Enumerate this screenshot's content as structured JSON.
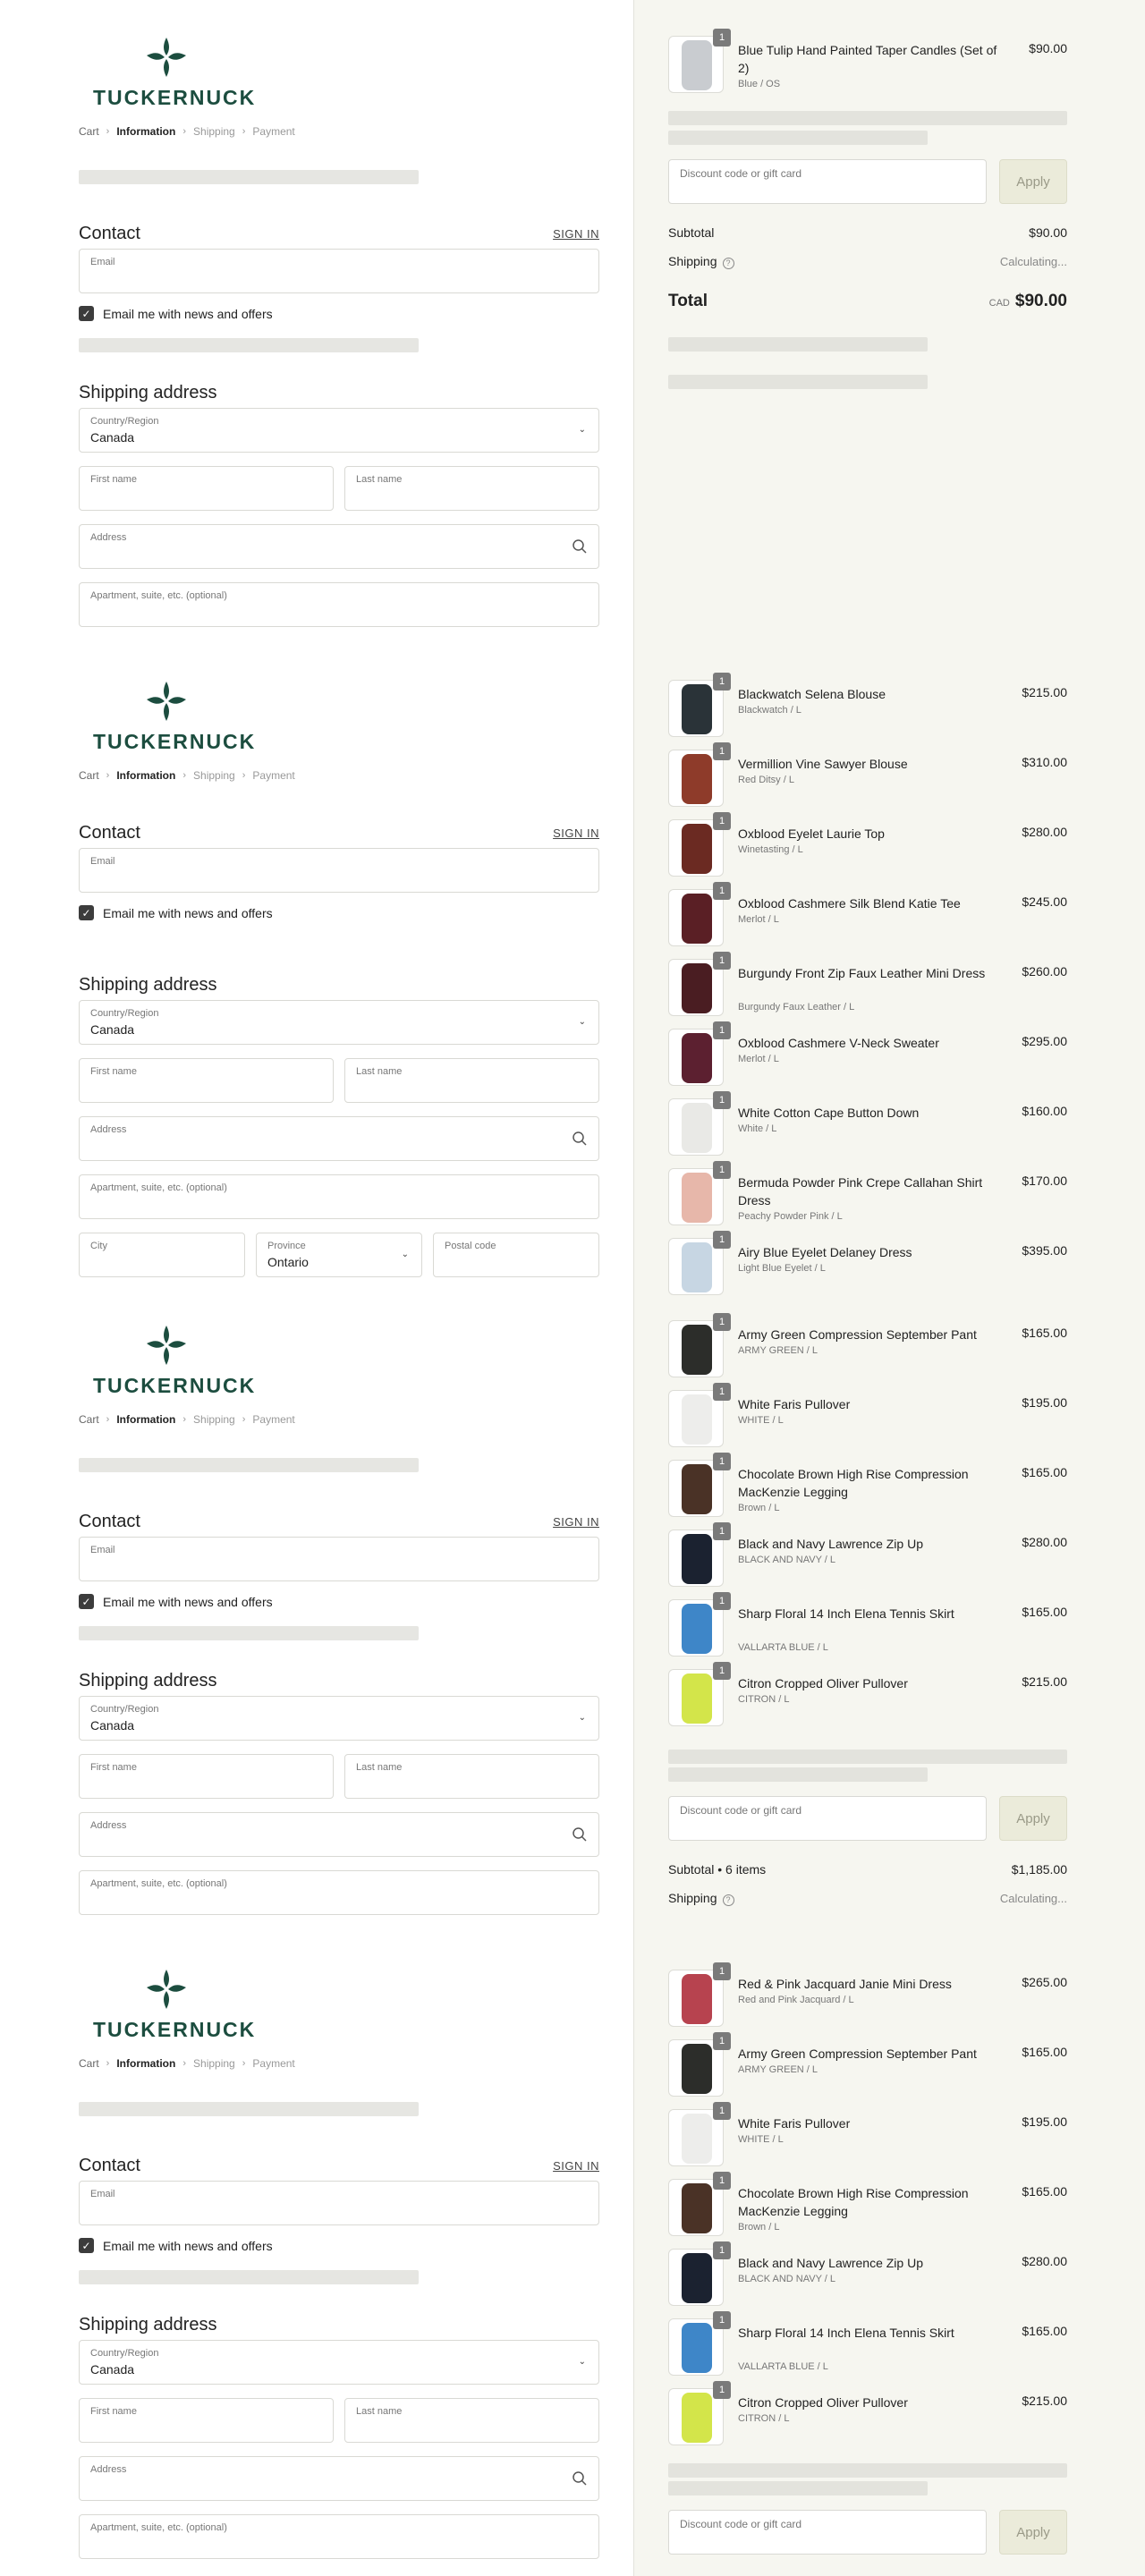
{
  "brand": {
    "wordmark": "TUCKERNUCK",
    "color": "#1c4d3f"
  },
  "crumbs": {
    "cart": "Cart",
    "information": "Information",
    "shipping": "Shipping",
    "payment": "Payment"
  },
  "contact": {
    "heading": "Contact",
    "sign_in": "SIGN IN",
    "email_label": "Email",
    "news_label": "Email me with news and offers"
  },
  "shipping": {
    "heading": "Shipping address",
    "country_label": "Country/Region",
    "country_value": "Canada",
    "first_name": "First name",
    "last_name": "Last name",
    "address": "Address",
    "apartment": "Apartment, suite, etc. (optional)",
    "city": "City",
    "province_label": "Province",
    "province_value": "Ontario",
    "postal": "Postal code"
  },
  "summary": {
    "discount_placeholder": "Discount code or gift card",
    "apply": "Apply",
    "subtotal_label": "Subtotal",
    "subtotal_items_label": "Subtotal • 6 items",
    "subtotal_1": "$90.00",
    "subtotal_2": "$1,185.00",
    "shipping_label": "Shipping",
    "shipping_value": "Calculating...",
    "total_label": "Total",
    "currency": "CAD",
    "total_value": "$90.00"
  },
  "items_top": [
    {
      "qty": "1",
      "name": "Blue Tulip Hand Painted Taper Candles (Set of 2)",
      "variant": "Blue / OS",
      "price": "$90.00",
      "color": "#c9ccd0"
    }
  ],
  "items_mid": [
    {
      "qty": "1",
      "name": "Blackwatch Selena Blouse",
      "variant": "Blackwatch / L",
      "price": "$215.00",
      "color": "#2a3338"
    },
    {
      "qty": "1",
      "name": "Vermillion Vine Sawyer Blouse",
      "variant": "Red Ditsy / L",
      "price": "$310.00",
      "color": "#8e3b2a"
    },
    {
      "qty": "1",
      "name": "Oxblood Eyelet Laurie Top",
      "variant": "Winetasting / L",
      "price": "$280.00",
      "color": "#6b2a22"
    },
    {
      "qty": "1",
      "name": "Oxblood Cashmere Silk Blend Katie Tee",
      "variant": "Merlot / L",
      "price": "$245.00",
      "color": "#5a1f25"
    },
    {
      "qty": "1",
      "name": "Burgundy Front Zip Faux Leather Mini Dress",
      "variant": "Burgundy Faux Leather / L",
      "price": "$260.00",
      "color": "#4a1d22"
    },
    {
      "qty": "1",
      "name": "Oxblood Cashmere V-Neck Sweater",
      "variant": "Merlot / L",
      "price": "$295.00",
      "color": "#5c2030"
    },
    {
      "qty": "1",
      "name": "White Cotton Cape Button Down",
      "variant": "White / L",
      "price": "$160.00",
      "color": "#e9e9e6"
    },
    {
      "qty": "1",
      "name": "Bermuda Powder Pink Crepe Callahan Shirt Dress",
      "variant": "Peachy Powder Pink / L",
      "price": "$170.00",
      "color": "#e7b7aa"
    },
    {
      "qty": "1",
      "name": "Airy Blue Eyelet Delaney Dress",
      "variant": "Light Blue Eyelet / L",
      "price": "$395.00",
      "color": "#c7d6e3"
    },
    {
      "qty": "1",
      "name": "Army Green Compression September Pant",
      "variant": "ARMY GREEN / L",
      "price": "$165.00",
      "color": "#2c2d2a"
    },
    {
      "qty": "1",
      "name": "White Faris Pullover",
      "variant": "WHITE / L",
      "price": "$195.00",
      "color": "#ededeb"
    },
    {
      "qty": "1",
      "name": "Chocolate Brown High Rise Compression MacKenzie Legging",
      "variant": "Brown / L",
      "price": "$165.00",
      "color": "#4a3226"
    },
    {
      "qty": "1",
      "name": "Black and Navy Lawrence Zip Up",
      "variant": "BLACK AND NAVY / L",
      "price": "$280.00",
      "color": "#1b2230"
    },
    {
      "qty": "1",
      "name": "Sharp Floral 14 Inch Elena Tennis Skirt",
      "variant": "VALLARTA BLUE / L",
      "price": "$165.00",
      "color": "#3e86c8"
    },
    {
      "qty": "1",
      "name": "Citron Cropped Oliver Pullover",
      "variant": "CITRON / L",
      "price": "$215.00",
      "color": "#d3e54a"
    }
  ],
  "items_bottom": [
    {
      "qty": "1",
      "name": "Red & Pink Jacquard Janie Mini Dress",
      "variant": "Red and Pink Jacquard / L",
      "price": "$265.00",
      "color": "#b7434f"
    },
    {
      "qty": "1",
      "name": "Army Green Compression September Pant",
      "variant": "ARMY GREEN / L",
      "price": "$165.00",
      "color": "#2c2d2a"
    },
    {
      "qty": "1",
      "name": "White Faris Pullover",
      "variant": "WHITE / L",
      "price": "$195.00",
      "color": "#ededeb"
    },
    {
      "qty": "1",
      "name": "Chocolate Brown High Rise Compression MacKenzie Legging",
      "variant": "Brown / L",
      "price": "$165.00",
      "color": "#4a3226"
    },
    {
      "qty": "1",
      "name": "Black and Navy Lawrence Zip Up",
      "variant": "BLACK AND NAVY / L",
      "price": "$280.00",
      "color": "#1b2230"
    },
    {
      "qty": "1",
      "name": "Sharp Floral 14 Inch Elena Tennis Skirt",
      "variant": "VALLARTA BLUE / L",
      "price": "$165.00",
      "color": "#3e86c8"
    },
    {
      "qty": "1",
      "name": "Citron Cropped Oliver Pullover",
      "variant": "CITRON / L",
      "price": "$215.00",
      "color": "#d3e54a"
    }
  ]
}
